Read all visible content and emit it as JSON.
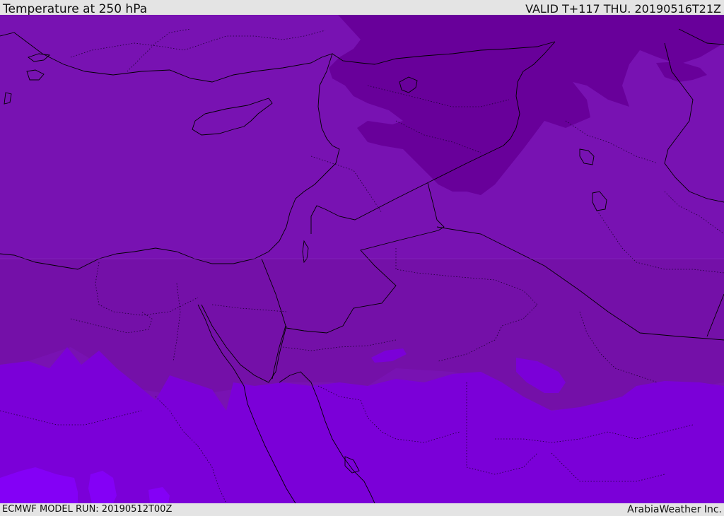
{
  "header": {
    "title": "Temperature at 250 hPa",
    "valid": "VALID T+117 THU. 20190516T21Z"
  },
  "footer": {
    "model_run": "ECMWF MODEL RUN: 20190512T00Z",
    "brand": "ArabiaWeather Inc."
  },
  "map": {
    "field": "Temperature at 250 hPa",
    "colors": {
      "band_cold": "#68009a",
      "band_mid": "#7812b2",
      "band_south": "#7b00d8",
      "band_warm": "#8400f6",
      "coastline": "#000000",
      "border": "#000000"
    }
  }
}
